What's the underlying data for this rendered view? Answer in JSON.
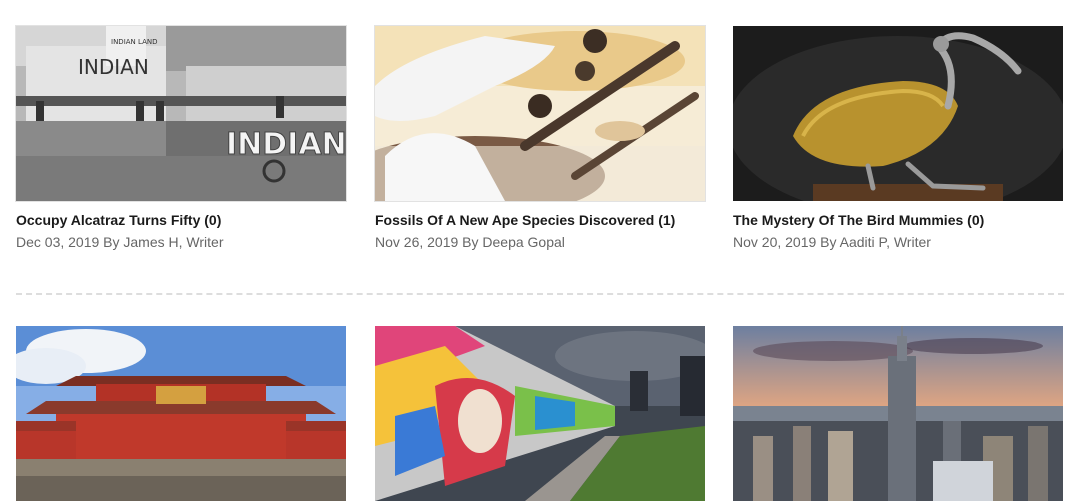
{
  "articles": [
    {
      "title": "Occupy Alcatraz Turns Fifty (0)",
      "meta": "Dec 03, 2019 By James H, Writer",
      "image": "alcatraz-indian-occupation-photo",
      "image_text": [
        "INDIAN",
        "INDIAN LAND",
        "INDIAN"
      ]
    },
    {
      "title": "Fossils Of A New Ape Species Discovered (1)",
      "meta": "Nov 26, 2019 By Deepa Gopal",
      "image": "gloved-hands-holding-fossil-bones-photo"
    },
    {
      "title": "The Mystery Of The Bird Mummies (0)",
      "meta": "Nov 20, 2019 By Aaditi P, Writer",
      "image": "gold-ibis-bird-statue-photo"
    },
    {
      "title": "",
      "meta": "",
      "image": "red-japanese-castle-photo"
    },
    {
      "title": "",
      "meta": "",
      "image": "berlin-wall-graffiti-photo"
    },
    {
      "title": "",
      "meta": "",
      "image": "new-york-skyline-sunset-photo"
    }
  ],
  "colors": {
    "title_text": "#1a1a1a",
    "meta_text": "#666666",
    "divider": "#dddddd"
  }
}
